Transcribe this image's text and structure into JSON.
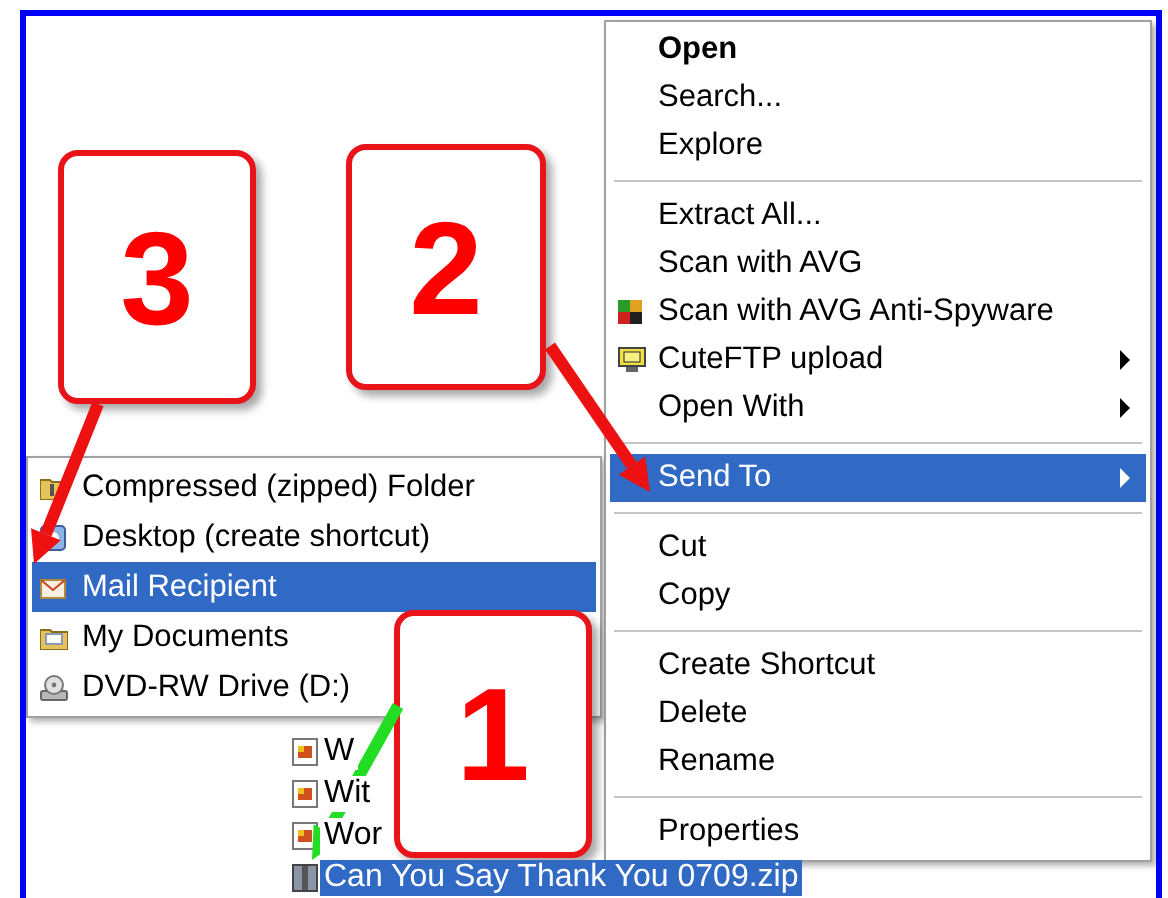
{
  "files": [
    {
      "name": "W",
      "selected": false
    },
    {
      "name": "Wit",
      "selected": false
    },
    {
      "name": "Wor",
      "selected": false
    },
    {
      "name": "Can You Say Thank You 0709.zip",
      "selected": true
    }
  ],
  "send_to_menu": {
    "items": [
      {
        "label": "Compressed (zipped) Folder",
        "selected": false
      },
      {
        "label": "Desktop (create shortcut)",
        "selected": false
      },
      {
        "label": "Mail Recipient",
        "selected": true
      },
      {
        "label": "My Documents",
        "selected": false
      },
      {
        "label": "DVD-RW Drive (D:)",
        "selected": false
      }
    ]
  },
  "context_menu": {
    "groups": [
      [
        {
          "label": "Open",
          "default": true,
          "submenu": false,
          "selected": false
        },
        {
          "label": "Search...",
          "default": false,
          "submenu": false,
          "selected": false
        },
        {
          "label": "Explore",
          "default": false,
          "submenu": false,
          "selected": false
        }
      ],
      [
        {
          "label": "Extract All...",
          "default": false,
          "submenu": false,
          "selected": false
        },
        {
          "label": "Scan with AVG",
          "default": false,
          "submenu": false,
          "selected": false
        },
        {
          "label": "Scan with AVG Anti-Spyware",
          "default": false,
          "submenu": false,
          "selected": false
        },
        {
          "label": "CuteFTP upload",
          "default": false,
          "submenu": true,
          "selected": false
        },
        {
          "label": "Open With",
          "default": false,
          "submenu": true,
          "selected": false
        }
      ],
      [
        {
          "label": "Send To",
          "default": false,
          "submenu": true,
          "selected": true
        }
      ],
      [
        {
          "label": "Cut",
          "default": false,
          "submenu": false,
          "selected": false
        },
        {
          "label": "Copy",
          "default": false,
          "submenu": false,
          "selected": false
        }
      ],
      [
        {
          "label": "Create Shortcut",
          "default": false,
          "submenu": false,
          "selected": false
        },
        {
          "label": "Delete",
          "default": false,
          "submenu": false,
          "selected": false
        },
        {
          "label": "Rename",
          "default": false,
          "submenu": false,
          "selected": false
        }
      ],
      [
        {
          "label": "Properties",
          "default": false,
          "submenu": false,
          "selected": false
        }
      ]
    ]
  },
  "callouts": [
    {
      "number": "3"
    },
    {
      "number": "2"
    },
    {
      "number": "1"
    }
  ],
  "arrows": [
    {
      "color": "#ee1111"
    },
    {
      "color": "#ee1111"
    },
    {
      "color": "#22dd22"
    }
  ]
}
